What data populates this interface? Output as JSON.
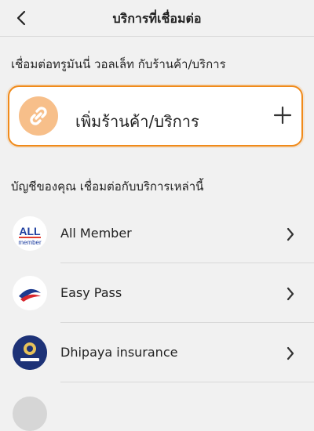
{
  "header": {
    "title": "บริการที่เชื่อมต่อ"
  },
  "section1": {
    "label": "เชื่อมต่อทรูมันนี่ วอลเล็ท กับร้านค้า/บริการ"
  },
  "add_card": {
    "label": "เพิ่มร้านค้า/บริการ"
  },
  "section2": {
    "label": "บัญชีของคุณ เชื่อมต่อกับบริการเหล่านี้"
  },
  "services": [
    {
      "name": "All Member",
      "logo_text": "ALL",
      "logo_subtext": "member"
    },
    {
      "name": "Easy Pass"
    },
    {
      "name": "Dhipaya insurance"
    }
  ],
  "colors": {
    "accent": "#f08a1a",
    "add_icon_bg": "#f7bf8a",
    "background": "#f1f1f1"
  },
  "icons": [
    "back-chevron",
    "link-icon",
    "plus-icon",
    "chevron-right"
  ]
}
